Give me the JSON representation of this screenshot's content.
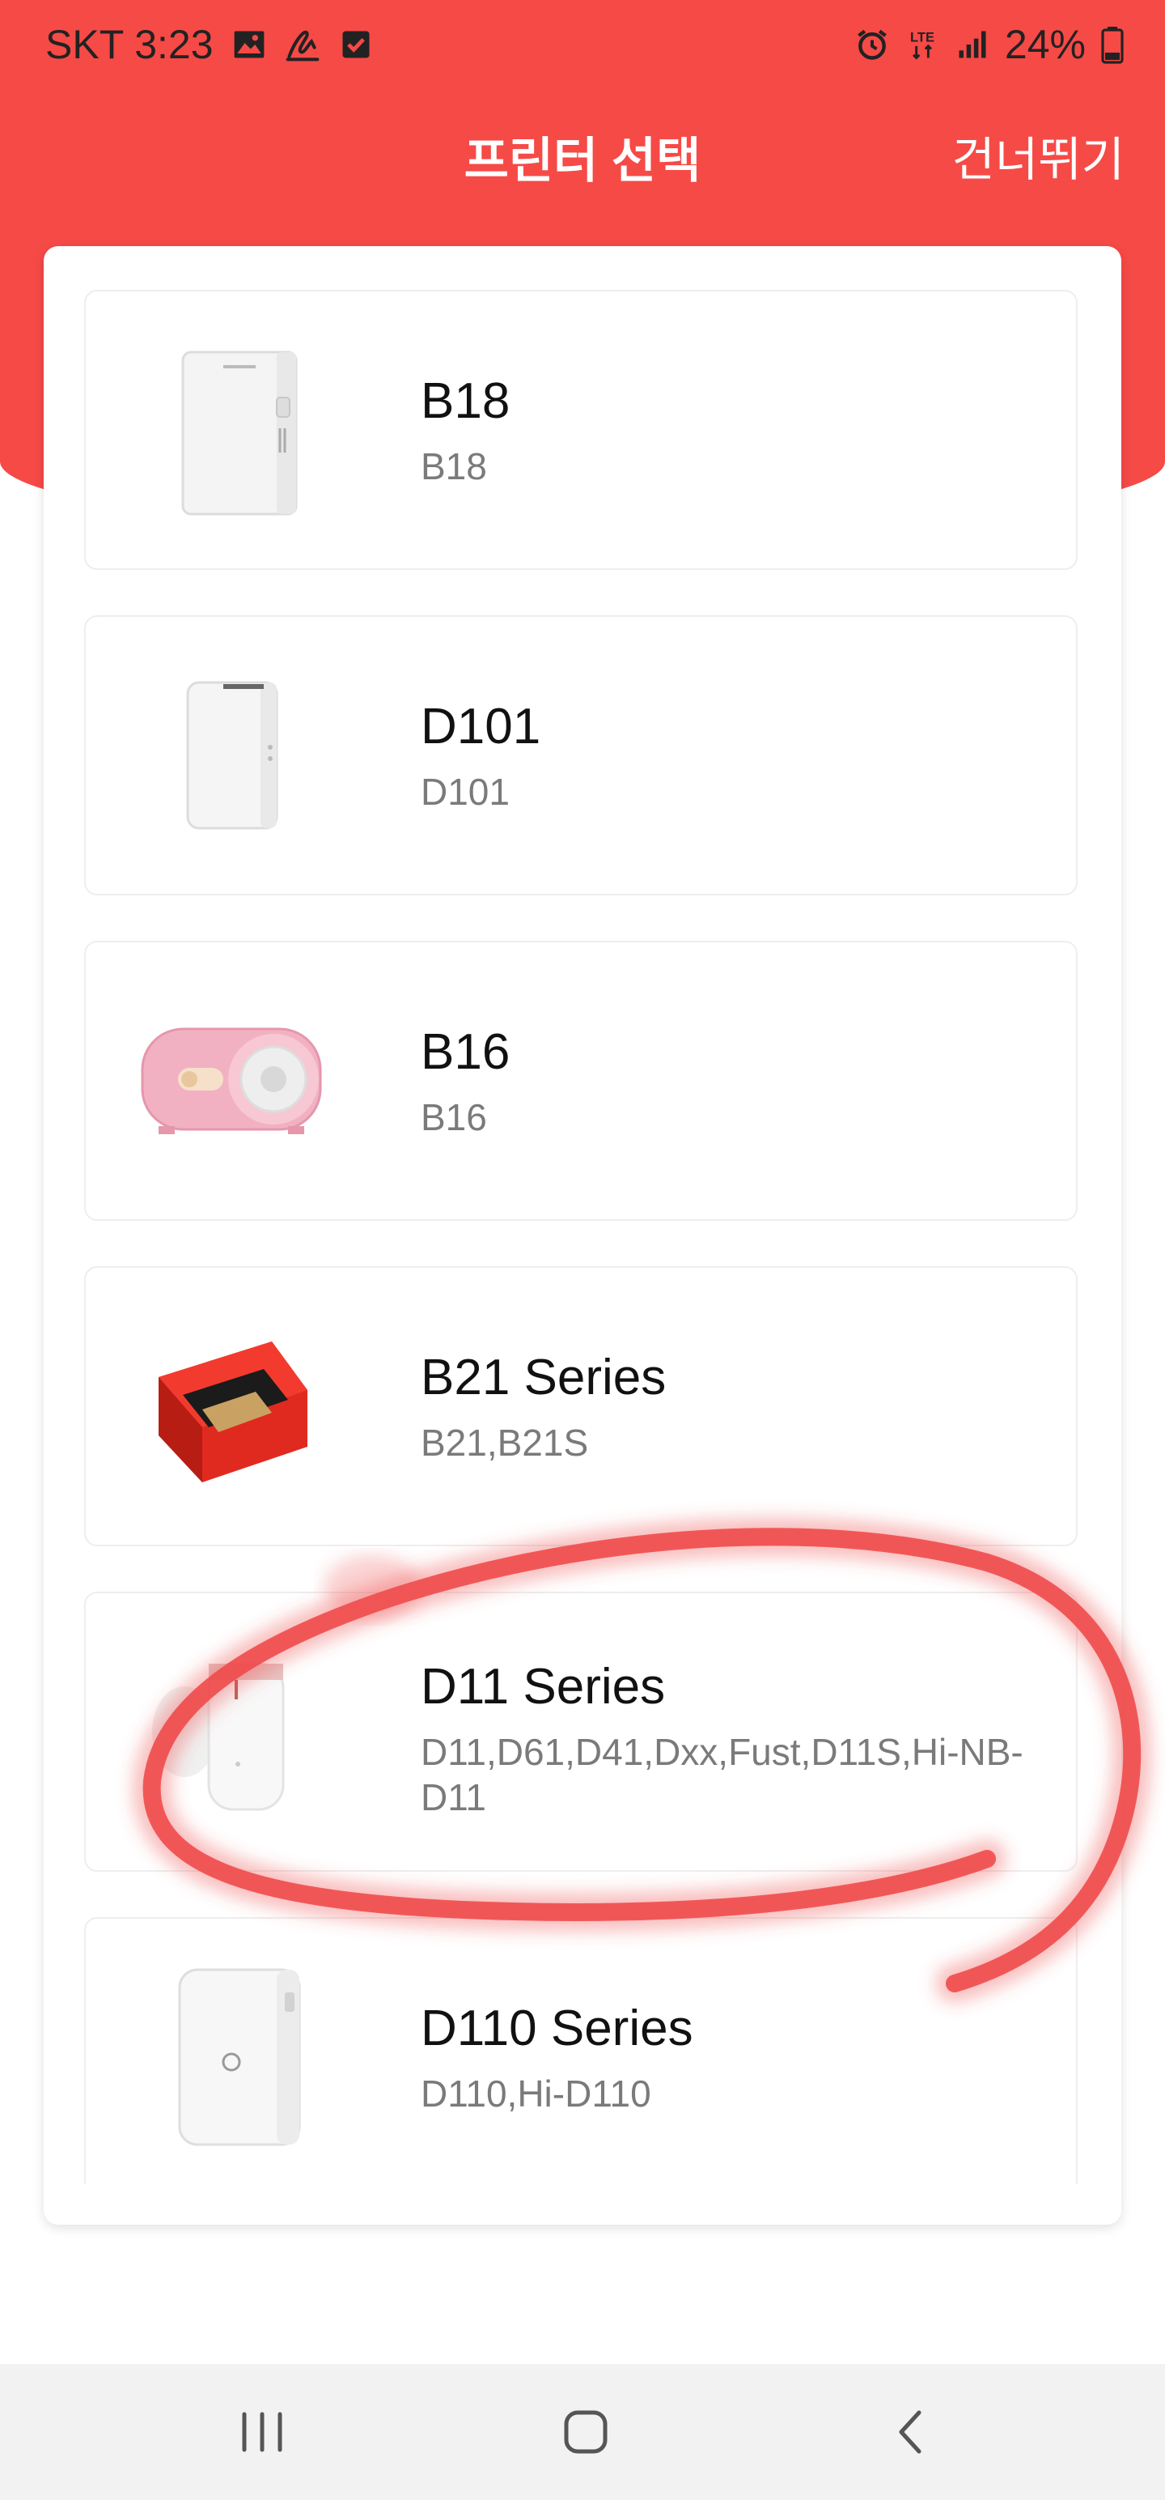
{
  "status_bar": {
    "carrier_time": "SKT 3:23",
    "network": "LTE",
    "battery": "24%"
  },
  "header": {
    "title": "프린터 선택",
    "skip_label": "건너뛰기"
  },
  "printers": [
    {
      "name": "B18",
      "models": "B18",
      "icon": "b18-printer-image"
    },
    {
      "name": "D101",
      "models": "D101",
      "icon": "d101-printer-image"
    },
    {
      "name": "B16",
      "models": "B16",
      "icon": "b16-printer-image"
    },
    {
      "name": "B21 Series",
      "models": "B21,B21S",
      "icon": "b21-printer-image"
    },
    {
      "name": "D11 Series",
      "models": "D11,D61,D41,Dxx,Fust,D11S,Hi-NB-D11",
      "icon": "d11-printer-image"
    },
    {
      "name": "D110 Series",
      "models": "D110,Hi-D110",
      "icon": "d110-printer-image"
    }
  ],
  "nav": {
    "recents": "recents-icon",
    "home": "home-icon",
    "back": "back-icon"
  },
  "colors": {
    "accent": "#f64a47",
    "annotation": "#ef4a4a"
  }
}
